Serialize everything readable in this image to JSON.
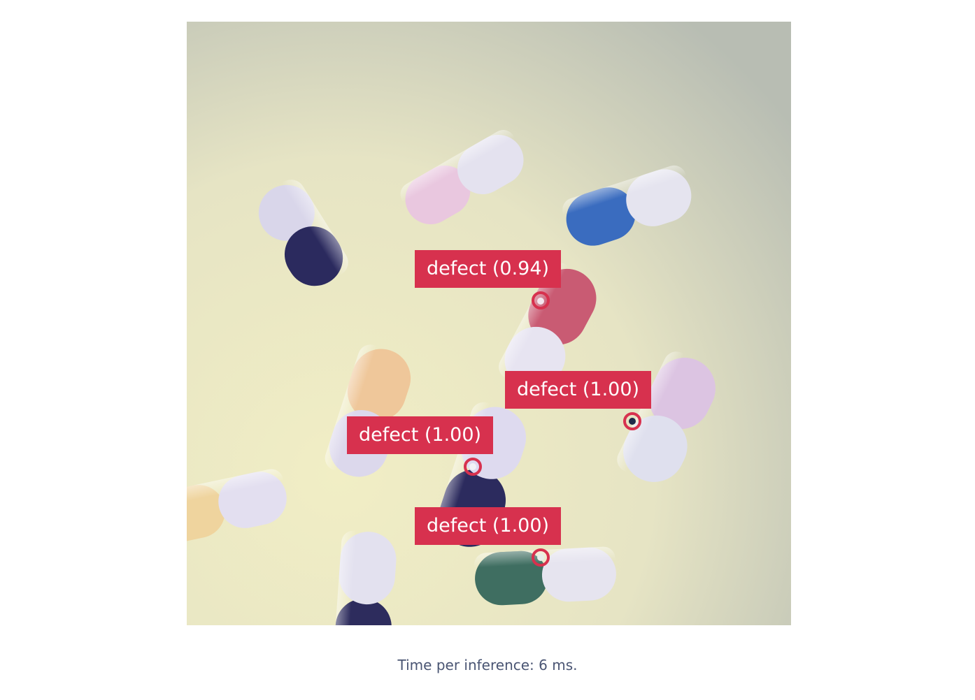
{
  "detections": [
    {
      "label": "defect (0.94)",
      "class": "defect",
      "score": 0.94
    },
    {
      "label": "defect (1.00)",
      "class": "defect",
      "score": 1.0
    },
    {
      "label": "defect (1.00)",
      "class": "defect",
      "score": 1.0
    },
    {
      "label": "defect (1.00)",
      "class": "defect",
      "score": 1.0
    }
  ],
  "footer": {
    "inference_text": "Time per inference: 6 ms."
  },
  "colors": {
    "detection_accent": "#d7314e",
    "footer_text": "#4a5573",
    "background": "#ffffff"
  }
}
